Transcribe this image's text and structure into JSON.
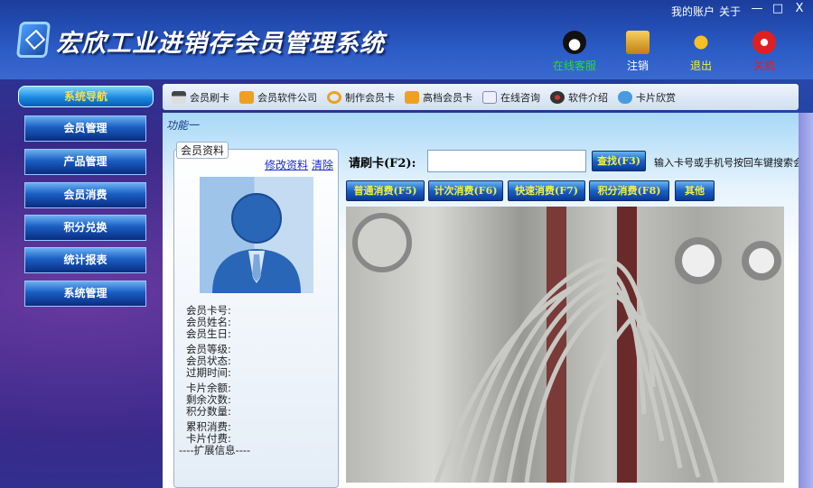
{
  "app": {
    "title": "宏欣工业进销存会员管理系统"
  },
  "top_links": [
    "我的账户",
    "关于"
  ],
  "window_controls": {
    "minimize": "—",
    "maximize": "□",
    "close": "X"
  },
  "top_tools": [
    {
      "label": "在线客服",
      "icon": "qq-penguin-icon",
      "color": "#22dd33"
    },
    {
      "label": "注销",
      "icon": "lock-icon",
      "color": "#ffffff"
    },
    {
      "label": "退出",
      "icon": "running-man-icon",
      "color": "#f0f040"
    },
    {
      "label": "关机",
      "icon": "power-icon",
      "color": "#e02020"
    }
  ],
  "nav": {
    "header": "系统导航",
    "items": [
      "会员管理",
      "产品管理",
      "会员消费",
      "积分兑换",
      "统计报表",
      "系统管理"
    ]
  },
  "toolbar": [
    {
      "label": "会员刷卡",
      "icon": "card-reader-icon"
    },
    {
      "label": "会员软件公司",
      "icon": "house-icon"
    },
    {
      "label": "制作会员卡",
      "icon": "refresh-icon"
    },
    {
      "label": "高档会员卡",
      "icon": "house-icon"
    },
    {
      "label": "在线咨询",
      "icon": "mail-icon"
    },
    {
      "label": "软件介绍",
      "icon": "disc-icon"
    },
    {
      "label": "卡片欣赏",
      "icon": "cloud-icon"
    }
  ],
  "main": {
    "section_title": "功能一",
    "member": {
      "group_title": "会员资料",
      "edit_link": "修改资料",
      "clear_link": "清除",
      "fields": [
        "会员卡号:",
        "会员姓名:",
        "会员生日:",
        "会员等级:",
        "会员状态:",
        "过期时间:",
        "卡片余额:",
        "剩余次数:",
        "积分数量:",
        "累积消费:",
        "卡片付费:"
      ],
      "ext": "----扩展信息----"
    },
    "search": {
      "label": "请刷卡(F2):",
      "value": "",
      "button": "查找(F3)",
      "hint": "输入卡号或手机号按回车键搜索会"
    },
    "actions": [
      "普通消费(F5)",
      "计次消费(F6)",
      "快速消费(F7)",
      "积分消费(F8)",
      "其他"
    ]
  }
}
